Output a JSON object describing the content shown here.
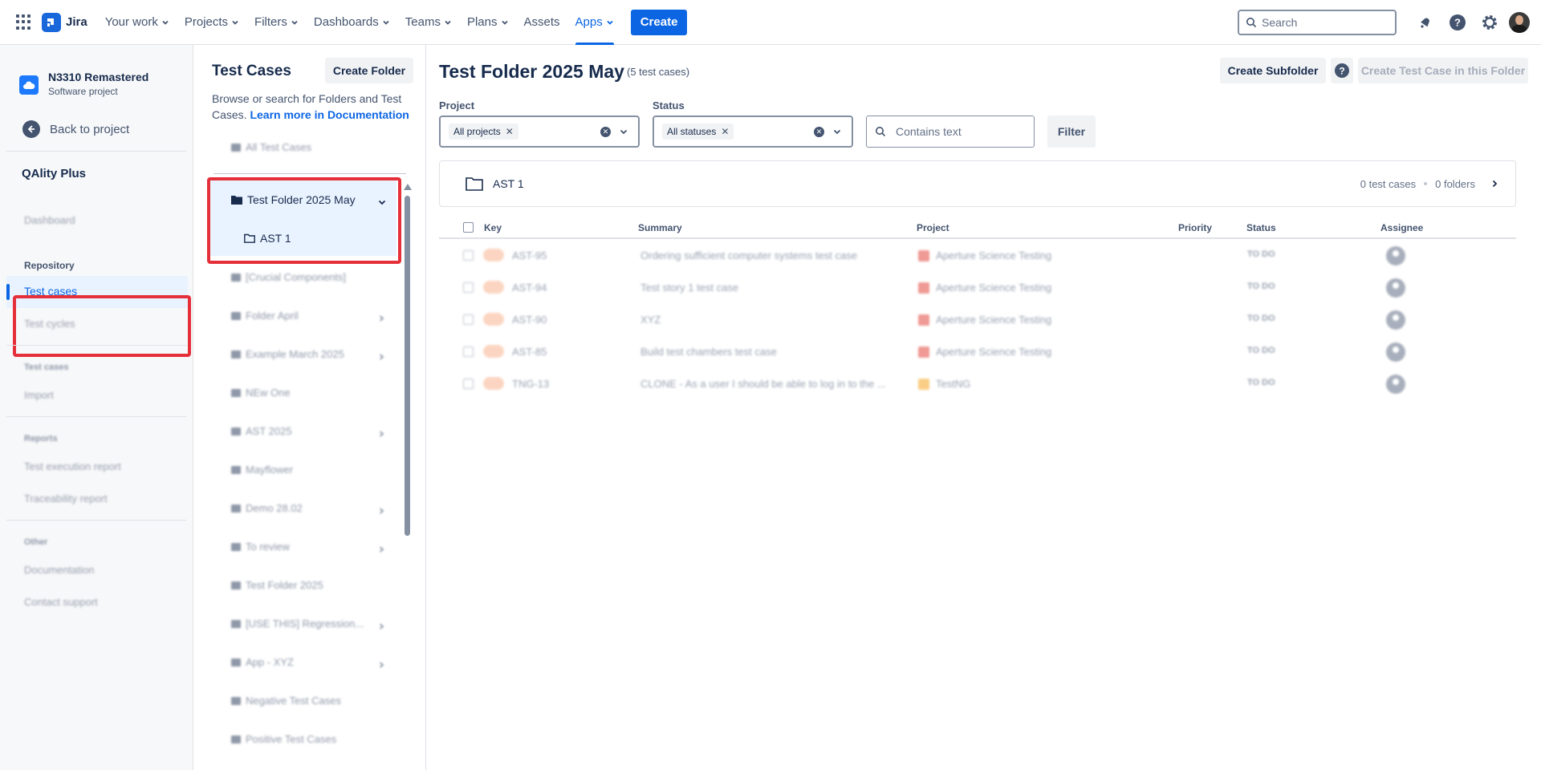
{
  "topnav": {
    "logo_text": "Jira",
    "items": [
      {
        "label": "Your work",
        "dropdown": true
      },
      {
        "label": "Projects",
        "dropdown": true
      },
      {
        "label": "Filters",
        "dropdown": true
      },
      {
        "label": "Dashboards",
        "dropdown": true
      },
      {
        "label": "Teams",
        "dropdown": true
      },
      {
        "label": "Plans",
        "dropdown": true
      },
      {
        "label": "Assets",
        "dropdown": false
      },
      {
        "label": "Apps",
        "dropdown": true,
        "active": true
      }
    ],
    "create_label": "Create",
    "search_placeholder": "Search"
  },
  "sidebar": {
    "project_name": "N3310 Remastered",
    "project_type": "Software project",
    "back_label": "Back to project",
    "app_name": "QAlity Plus",
    "dashboard_label": "Dashboard",
    "repository_header": "Repository",
    "test_cases_label": "Test cases",
    "test_cycles_label": "Test cycles",
    "testcases_header": "Test cases",
    "import_label": "Import",
    "reports_header": "Reports",
    "exec_report_label": "Test execution report",
    "trace_report_label": "Traceability report",
    "other_header": "Other",
    "documentation_label": "Documentation",
    "contact_label": "Contact support"
  },
  "middle": {
    "title": "Test Cases",
    "create_folder_label": "Create Folder",
    "description": "Browse or search for Folders and Test Cases.",
    "learn_more": "Learn more in Documentation",
    "all_test_cases": "All Test Cases",
    "selected_folder": "Test Folder 2025 May",
    "selected_subfolder": "AST 1",
    "folders": [
      {
        "label": "[Crucial Components]",
        "arrow": false
      },
      {
        "label": "Folder April",
        "arrow": true
      },
      {
        "label": "Example March 2025",
        "arrow": true
      },
      {
        "label": "NEw One",
        "arrow": false
      },
      {
        "label": "AST 2025",
        "arrow": true
      },
      {
        "label": "Mayflower",
        "arrow": false
      },
      {
        "label": "Demo 28.02",
        "arrow": true
      },
      {
        "label": "To review",
        "arrow": true
      },
      {
        "label": "Test Folder 2025",
        "arrow": false
      },
      {
        "label": "[USE THIS] Regression...",
        "arrow": true
      },
      {
        "label": "App - XYZ",
        "arrow": true
      },
      {
        "label": "Negative Test Cases",
        "arrow": false
      },
      {
        "label": "Positive Test Cases",
        "arrow": false
      }
    ]
  },
  "main": {
    "title": "Test Folder 2025 May",
    "count": "(5 test cases)",
    "create_subfolder_label": "Create Subfolder",
    "create_test_case_label": "Create Test Case in this Folder",
    "project_filter_label": "Project",
    "project_filter_chip": "All projects",
    "status_filter_label": "Status",
    "status_filter_chip": "All statuses",
    "text_filter_placeholder": "Contains text",
    "filter_button_label": "Filter",
    "subfolder": {
      "name": "AST 1",
      "test_cases": "0 test cases",
      "folders": "0 folders"
    },
    "columns": {
      "key": "Key",
      "summary": "Summary",
      "project": "Project",
      "priority": "Priority",
      "status": "Status",
      "assignee": "Assignee"
    },
    "rows": [
      {
        "key": "AST-95",
        "summary": "Ordering sufficient computer systems test case",
        "project": "Aperture Science Testing",
        "status": "TO DO",
        "project_color": "#e2483d"
      },
      {
        "key": "AST-94",
        "summary": "Test story 1 test case",
        "project": "Aperture Science Testing",
        "status": "TO DO",
        "project_color": "#e2483d"
      },
      {
        "key": "AST-90",
        "summary": "XYZ",
        "project": "Aperture Science Testing",
        "status": "TO DO",
        "project_color": "#e2483d"
      },
      {
        "key": "AST-85",
        "summary": "Build test chambers test case",
        "project": "Aperture Science Testing",
        "status": "TO DO",
        "project_color": "#e2483d"
      },
      {
        "key": "TNG-13",
        "summary": "CLONE - As a user I should be able to log in to the ...",
        "project": "TestNG",
        "status": "TO DO",
        "project_color": "#f5a623"
      }
    ]
  },
  "colors": {
    "accent": "#0c66e4",
    "highlight_red": "#e5303a",
    "selected_bg": "#e9f2ff"
  }
}
